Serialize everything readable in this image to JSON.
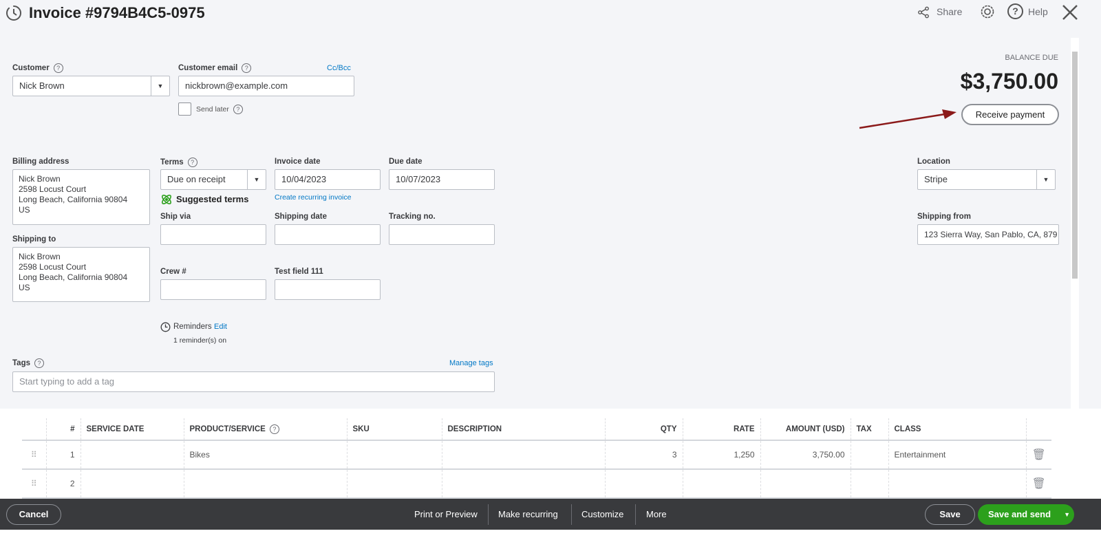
{
  "header": {
    "title": "Invoice #9794B4C5-0975",
    "share": "Share",
    "help": "Help"
  },
  "balance": {
    "label": "BALANCE DUE",
    "amount": "$3,750.00",
    "receive_payment": "Receive payment"
  },
  "customer": {
    "label": "Customer",
    "value": "Nick Brown"
  },
  "email": {
    "label": "Customer email",
    "value": "nickbrown@example.com",
    "cc_bcc": "Cc/Bcc",
    "send_later": "Send later"
  },
  "billing": {
    "label": "Billing address",
    "lines": [
      "Nick Brown",
      "2598 Locust Court",
      "Long Beach, California  90804",
      "US"
    ]
  },
  "shipping_to": {
    "label": "Shipping to",
    "lines": [
      "Nick Brown",
      "2598 Locust Court",
      "Long Beach, California  90804",
      "US"
    ]
  },
  "terms": {
    "label": "Terms",
    "value": "Due on receipt",
    "suggested": "Suggested terms"
  },
  "invoice_date": {
    "label": "Invoice date",
    "value": "10/04/2023",
    "recurring_link": "Create recurring invoice"
  },
  "due_date": {
    "label": "Due date",
    "value": "10/07/2023"
  },
  "ship_via": {
    "label": "Ship via",
    "value": ""
  },
  "shipping_date": {
    "label": "Shipping date",
    "value": ""
  },
  "tracking": {
    "label": "Tracking no.",
    "value": ""
  },
  "crew": {
    "label": "Crew #",
    "value": ""
  },
  "test_field": {
    "label": "Test field 111",
    "value": ""
  },
  "reminders": {
    "label": "Reminders",
    "edit": "Edit",
    "status": "1 reminder(s) on"
  },
  "location": {
    "label": "Location",
    "value": "Stripe"
  },
  "shipping_from": {
    "label": "Shipping from",
    "value": "123 Sierra Way, San Pablo, CA, 879"
  },
  "tags": {
    "label": "Tags",
    "manage": "Manage tags",
    "placeholder": "Start typing to add a tag"
  },
  "table": {
    "columns": [
      "#",
      "SERVICE DATE",
      "PRODUCT/SERVICE",
      "SKU",
      "DESCRIPTION",
      "QTY",
      "RATE",
      "AMOUNT (USD)",
      "TAX",
      "CLASS"
    ],
    "rows": [
      {
        "num": "1",
        "service_date": "",
        "product": "Bikes",
        "sku": "",
        "description": "",
        "qty": "3",
        "rate": "1,250",
        "amount": "3,750.00",
        "tax": "",
        "class": "Entertainment"
      },
      {
        "num": "2",
        "service_date": "",
        "product": "",
        "sku": "",
        "description": "",
        "qty": "",
        "rate": "",
        "amount": "",
        "tax": "",
        "class": ""
      }
    ]
  },
  "footer": {
    "cancel": "Cancel",
    "print": "Print or Preview",
    "recurring": "Make recurring",
    "customize": "Customize",
    "more": "More",
    "save": "Save",
    "save_send": "Save and send"
  },
  "colors": {
    "link": "#0077c5",
    "green": "#2ca01c",
    "footer_bg": "#393a3d",
    "arrow": "#8b1a1a"
  }
}
